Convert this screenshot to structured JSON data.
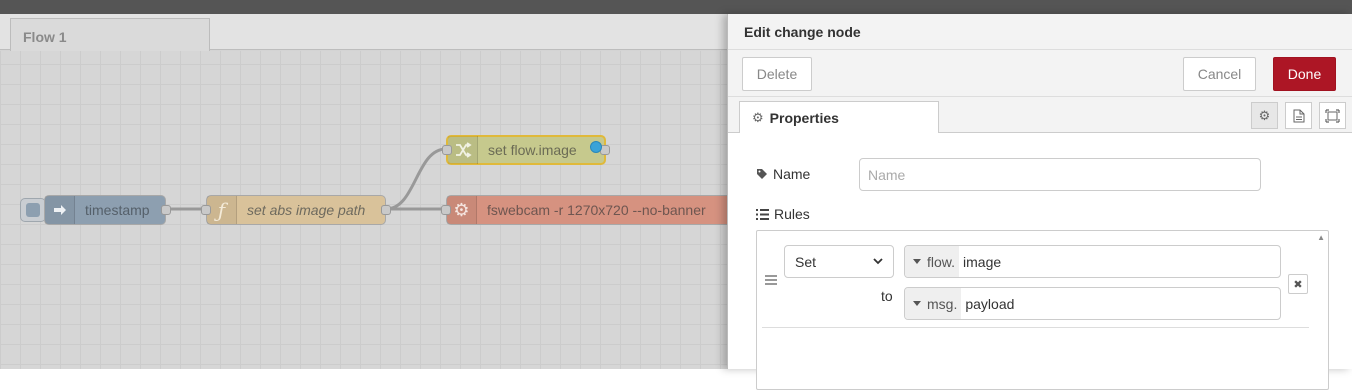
{
  "workspace": {
    "tab_label": "Flow 1",
    "nodes": {
      "timestamp": "timestamp",
      "function": "set abs image path",
      "change": "set flow.image",
      "exec": "fswebcam -r 1270x720 --no-banner"
    }
  },
  "tray": {
    "title": "Edit change node",
    "delete_label": "Delete",
    "cancel_label": "Cancel",
    "done_label": "Done",
    "properties_tab": "Properties",
    "name_label": "Name",
    "name_placeholder": "Name",
    "name_value": "",
    "rules_label": "Rules",
    "rules": [
      {
        "action": "Set",
        "target_type": "flow.",
        "target_value": "image",
        "to_label": "to",
        "source_type": "msg.",
        "source_value": "payload"
      }
    ]
  },
  "colors": {
    "done_button": "#ad1625",
    "timestamp_node": "#8d9fb0",
    "function_node": "#d9c29a",
    "change_node": "#c6c98d",
    "exec_node": "#d69280",
    "dirty_indicator": "#3aa3d8"
  },
  "icons": [
    "inject-arrow-icon",
    "function-icon",
    "shuffle-icon",
    "gear-icon",
    "tag-icon",
    "list-icon",
    "cog-icon",
    "file-icon",
    "expand-icon",
    "caret-down-icon",
    "remove-icon",
    "drag-handle-icon"
  ]
}
